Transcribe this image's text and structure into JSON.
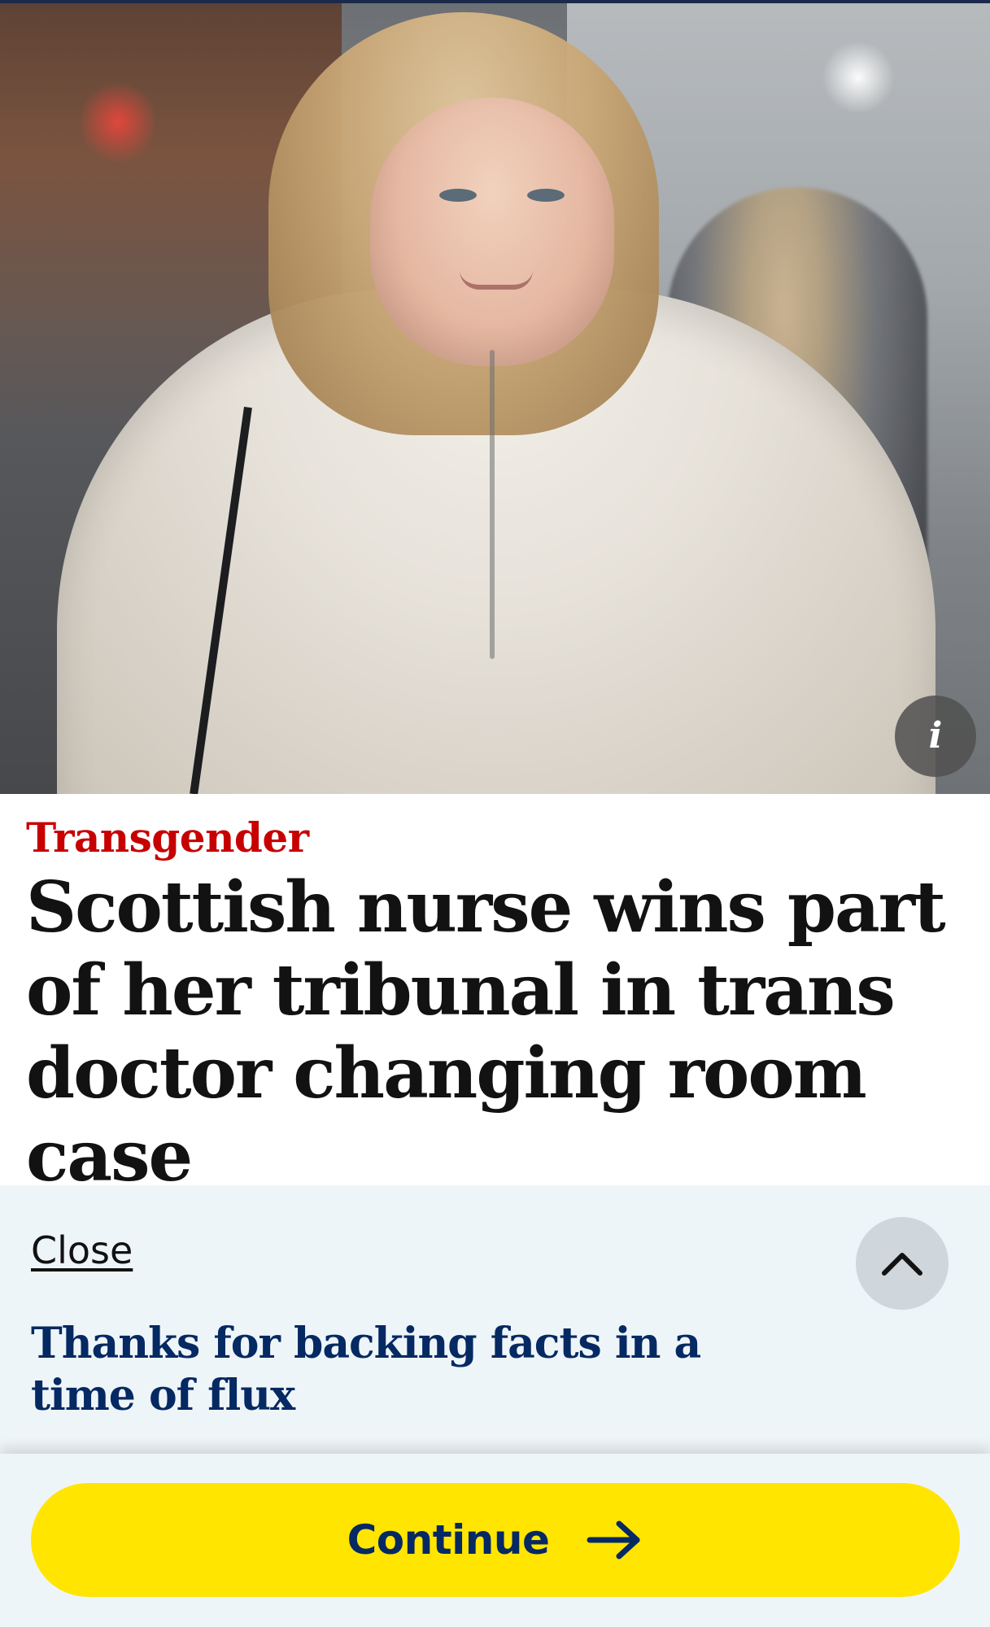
{
  "hero": {
    "info_icon": "i",
    "icon_names": {
      "info": "info-icon"
    }
  },
  "article": {
    "kicker": "Transgender",
    "headline": "Scottish nurse wins part of her tribunal in trans doctor changing room case"
  },
  "support_panel": {
    "close_label": "Close",
    "message": "Thanks for backing facts in a time of flux",
    "icon_names": {
      "collapse": "chevron-up-icon",
      "continue": "arrow-right-icon"
    }
  },
  "cta": {
    "continue_label": "Continue"
  },
  "colors": {
    "kicker": "#c70000",
    "headline": "#121212",
    "panel_bg": "#eef5f9",
    "support_text": "#052962",
    "cta_bg": "#ffe500",
    "cta_text": "#052962"
  }
}
